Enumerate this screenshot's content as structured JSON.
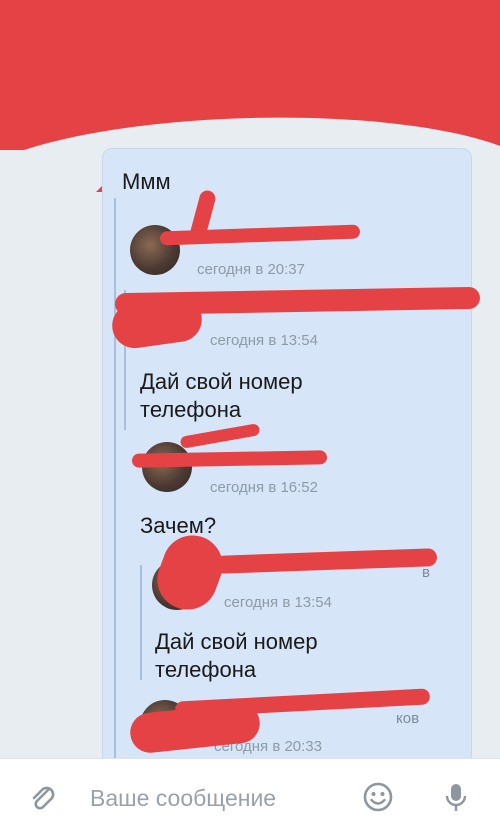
{
  "message": {
    "text": "Ммм",
    "forwarded": [
      {
        "time": "сегодня в 20:37"
      },
      {
        "time": "сегодня в 13:54",
        "text_line1": "Дай свой номер",
        "text_line2": "телефона"
      },
      {
        "time": "сегодня в 16:52",
        "text": "Зачем?"
      },
      {
        "time": "сегодня в 13:54",
        "text_line1": "Дай свой номер",
        "text_line2": "телефона",
        "name_fragment": "в"
      },
      {
        "time": "сегодня в 20:33",
        "name_fragment": "ков"
      }
    ]
  },
  "input": {
    "placeholder": "Ваше сообщение"
  },
  "icons": {
    "attach": "paperclip-icon",
    "emoji": "emoji-icon",
    "voice": "microphone-icon"
  },
  "colors": {
    "header": "#e54246",
    "bubble": "#d6e5f7",
    "meta_text": "#8e9aa8"
  }
}
